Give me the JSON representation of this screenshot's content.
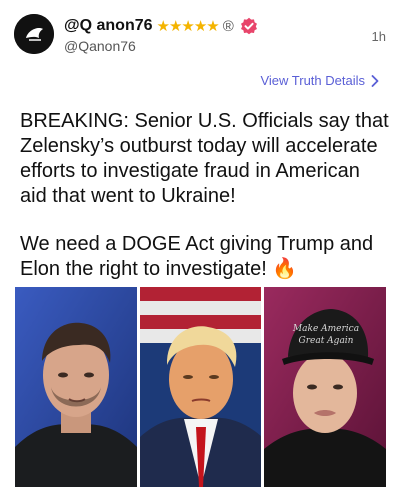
{
  "post": {
    "display_name": "@Q anon76",
    "stars": "★★★★★",
    "registered_mark": "®",
    "handle": "@Qanon76",
    "timestamp": "1h",
    "details_link": "View Truth Details",
    "paragraph1": "BREAKING: Senior U.S. Officials say that Zelensky’s outburst today will accelerate efforts to investigate fraud in American aid that went to Ukraine!",
    "paragraph2": "We need a DOGE Act giving Trump and Elon the right to investigate! 🔥",
    "hat_text": "Make America Great Again"
  },
  "colors": {
    "link": "#5a5fd6",
    "stars": "#f4b400",
    "verified_badge": "#e8456b"
  }
}
